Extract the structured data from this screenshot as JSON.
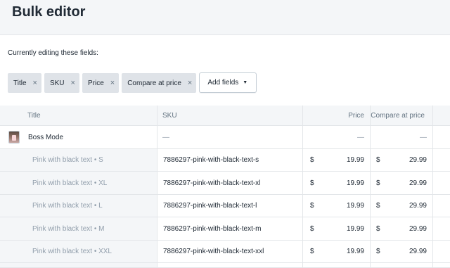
{
  "page": {
    "title": "Bulk editor"
  },
  "fields": {
    "caption": "Currently editing these fields:",
    "chips": [
      {
        "label": "Title"
      },
      {
        "label": "SKU"
      },
      {
        "label": "Price"
      },
      {
        "label": "Compare at price"
      }
    ],
    "remove_icon": "×",
    "add_button_label": "Add fields",
    "add_button_icon": "caret-down-icon"
  },
  "table": {
    "headers": {
      "title": "Title",
      "sku": "SKU",
      "price": "Price",
      "compare": "Compare at price"
    },
    "product": {
      "name": "Boss Mode",
      "sku": "—",
      "price": "—",
      "compare": "—"
    },
    "currency_symbol": "$",
    "variants": [
      {
        "title": "Pink with black text • S",
        "sku": "7886297-pink-with-black-text-s",
        "price": "19.99",
        "compare": "29.99"
      },
      {
        "title": "Pink with black text • XL",
        "sku": "7886297-pink-with-black-text-xl",
        "price": "19.99",
        "compare": "29.99"
      },
      {
        "title": "Pink with black text • L",
        "sku": "7886297-pink-with-black-text-l",
        "price": "19.99",
        "compare": "29.99"
      },
      {
        "title": "Pink with black text • M",
        "sku": "7886297-pink-with-black-text-m",
        "price": "19.99",
        "compare": "29.99"
      },
      {
        "title": "Pink with black text • XXL",
        "sku": "7886297-pink-with-black-text-xxl",
        "price": "19.99",
        "compare": "29.99"
      }
    ]
  }
}
